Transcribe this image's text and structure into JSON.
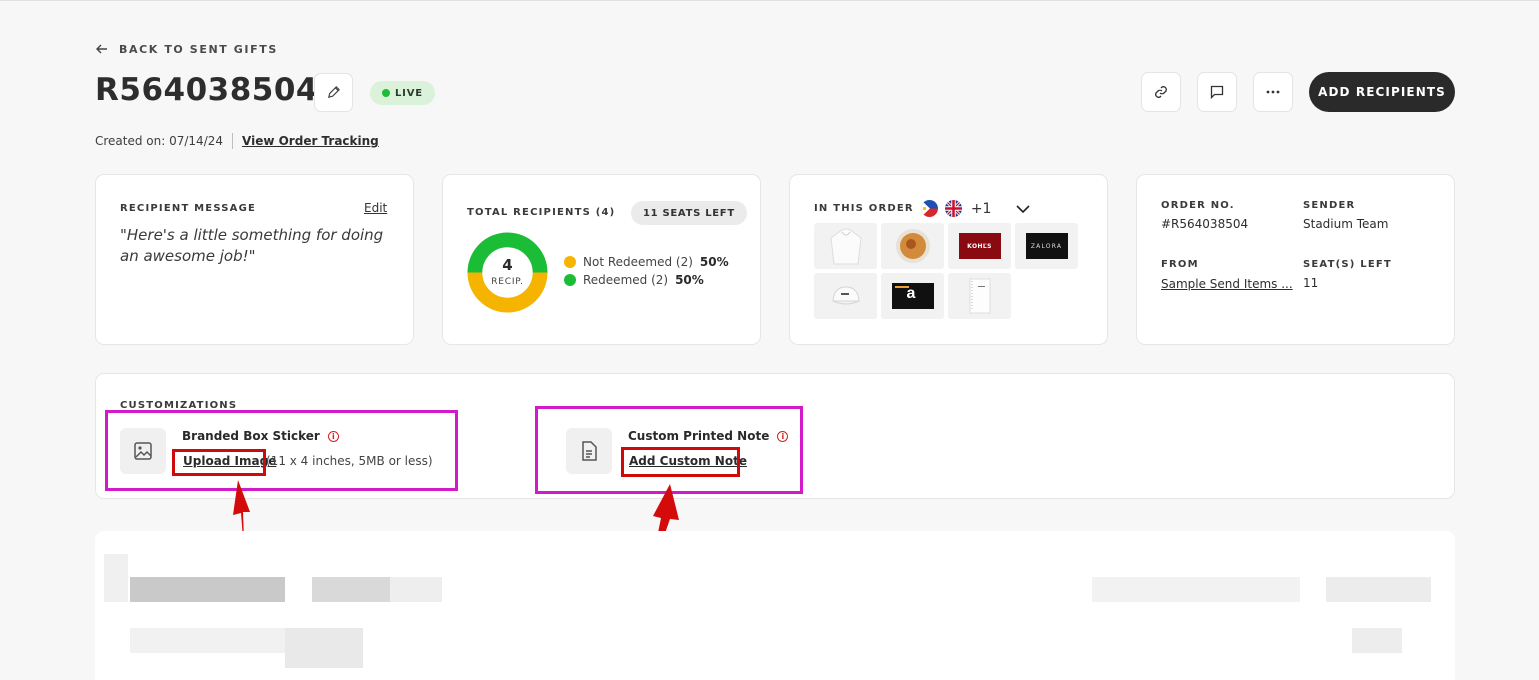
{
  "nav": {
    "back_label": "BACK TO SENT GIFTS"
  },
  "header": {
    "order_id": "R564038504",
    "status": "LIVE",
    "created": "Created on: 07/14/24",
    "tracking_link": "View Order Tracking",
    "add_recipients": "ADD RECIPIENTS",
    "actions": [
      "link-icon",
      "message-icon",
      "more-icon"
    ]
  },
  "recipient_message": {
    "label": "RECIPIENT MESSAGE",
    "edit": "Edit",
    "text": "\"Here's a little something for doing an awesome job!\""
  },
  "total_recipients": {
    "label": "TOTAL RECIPIENTS (4)",
    "seats_badge": "11 SEATS LEFT",
    "count": "4",
    "count_label": "RECIP.",
    "legend": [
      {
        "label": "Not Redeemed (2)",
        "pct": "50%",
        "color": "#f5b400"
      },
      {
        "label": "Redeemed (2)",
        "pct": "50%",
        "color": "#1cbd36"
      }
    ],
    "redeemed_fraction": 0.5
  },
  "in_this_order": {
    "label": "IN THIS ORDER",
    "more": "+1",
    "items": [
      "hoodie",
      "food-bowl",
      "kohls-card",
      "zalora-card",
      "cap",
      "amazon-card",
      "notebook"
    ],
    "brand_text": {
      "kohls": "KOHĽS",
      "zalora": "ZALORA",
      "amazon": "a"
    }
  },
  "order_meta": {
    "order_no_label": "ORDER NO.",
    "order_no": "#R564038504",
    "sender_label": "SENDER",
    "sender": "Stadium Team",
    "from_label": "FROM",
    "from": "Sample Send Items ...",
    "seats_label": "SEAT(S) LEFT",
    "seats": "11"
  },
  "customizations": {
    "label": "CUSTOMIZATIONS",
    "sticker": {
      "title": "Branded Box Sticker",
      "link": "Upload Image",
      "hint": "(11 x 4 inches, 5MB or less)"
    },
    "note": {
      "title": "Custom Printed Note",
      "link": "Add Custom Note"
    }
  },
  "colors": {
    "accent_dark": "#2a2a2a",
    "live_bg": "#d9f2d9",
    "annotation_magenta": "#d21ac8",
    "annotation_red": "#cf0a0a"
  }
}
